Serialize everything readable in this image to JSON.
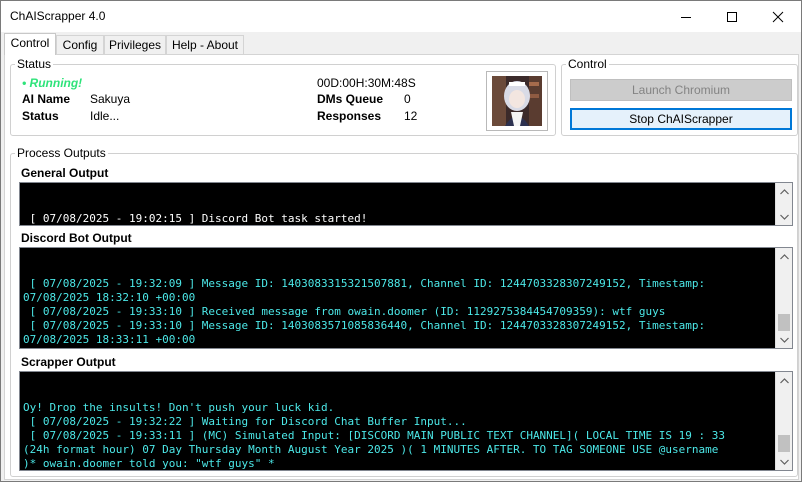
{
  "window": {
    "title": "ChAIScrapper 4.0"
  },
  "tabs": [
    {
      "label": "Control"
    },
    {
      "label": "Config"
    },
    {
      "label": "Privileges"
    },
    {
      "label": "Help - About"
    }
  ],
  "status": {
    "legend": "Status",
    "running": "• Running!",
    "uptime": "00D:00H:30M:48S",
    "ai_name_label": "AI Name",
    "ai_name_value": "Sakuya",
    "status_label": "Status",
    "status_value": "Idle...",
    "dms_label": "DMs Queue",
    "dms_value": "0",
    "responses_label": "Responses",
    "responses_value": "12"
  },
  "control": {
    "legend": "Control",
    "launch_label": "Launch Chromium",
    "stop_label": "Stop ChAIScrapper"
  },
  "outputs": {
    "legend": "Process Outputs",
    "general_title": "General Output",
    "general_text": " [ 07/08/2025 - 19:02:15 ] Discord Bot task started!",
    "discord_title": "Discord Bot Output",
    "discord_text": " [ 07/08/2025 - 19:32:09 ] Message ID: 1403083315321507881, Channel ID: 1244703328307249152, Timestamp:\n07/08/2025 18:32:10 +00:00\n [ 07/08/2025 - 19:33:10 ] Received message from owain.doomer (ID: 1129275384454709359): wtf guys\n [ 07/08/2025 - 19:33:10 ] Message ID: 1403083571085836440, Channel ID: 1244703328307249152, Timestamp:\n07/08/2025 18:33:11 +00:00",
    "scrapper_title": "Scrapper Output",
    "scrapper_text": "Oy! Drop the insults! Don't push your luck kid.\n [ 07/08/2025 - 19:32:22 ] Waiting for Discord Chat Buffer Input...\n [ 07/08/2025 - 19:33:11 ] (MC) Simulated Input: [DISCORD MAIN PUBLIC TEXT CHANNEL]( LOCAL TIME IS 19 : 33\n(24h format hour) 07 Day Thursday Month August Year 2025 )( 1 MINUTES AFTER. TO TAG SOMEONE USE @username\n)* owain.doomer told you: \"wtf guys\" *"
  }
}
